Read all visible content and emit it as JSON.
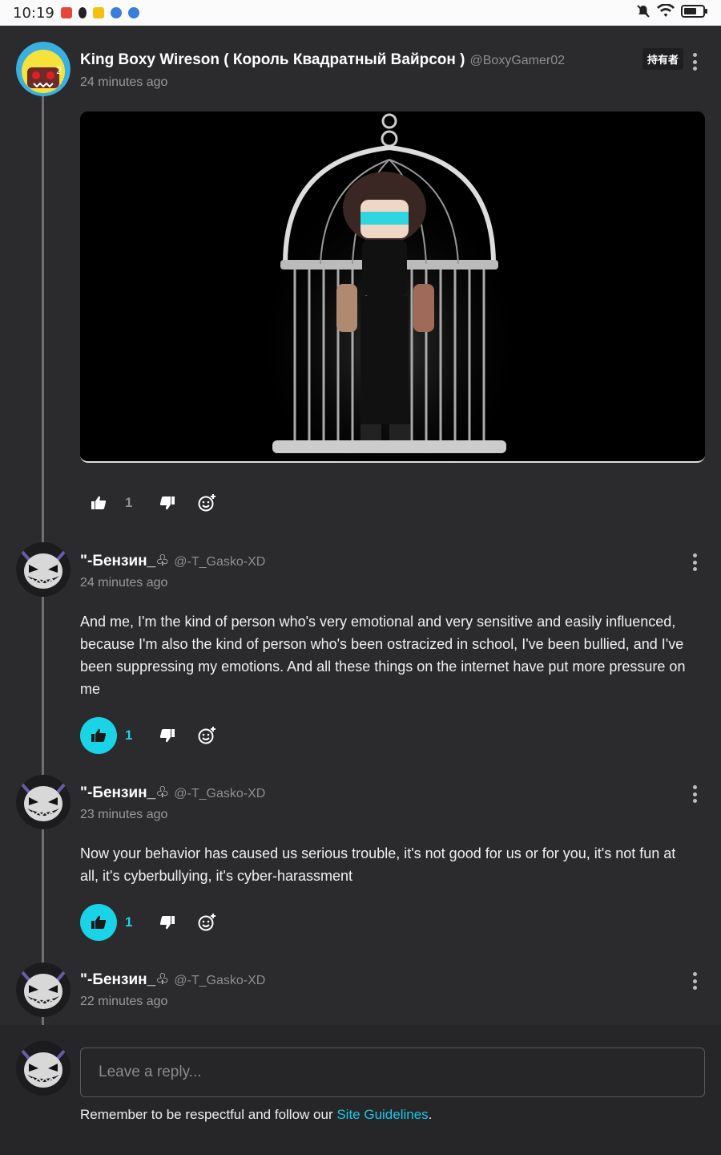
{
  "status_bar": {
    "time": "10:19"
  },
  "thread": {
    "original": {
      "username": "King Boxy Wireson ( Король Квадратный Вайрсон )",
      "handle": "@BoxyGamer02",
      "time": "24 minutes ago",
      "badge": "持有者",
      "likes": "1"
    },
    "replies": [
      {
        "username": "\"-Бензин_♧",
        "handle": "@-T_Gasko-XD",
        "time": "24 minutes ago",
        "text": "And me, I'm the kind of person who's very emotional and very sensitive and easily influenced, because I'm also the kind of person who's been ostracized in school, I've been bullied, and I've been suppressing my emotions. And all these things on the internet have put more pressure on me",
        "likes": "1"
      },
      {
        "username": "\"-Бензин_♧",
        "handle": "@-T_Gasko-XD",
        "time": "23 minutes ago",
        "text": "Now your behavior has caused us serious trouble, it's not good for us or for you, it's not fun at all, it's cyberbullying, it's cyber-harassment",
        "likes": "1"
      },
      {
        "username": "\"-Бензин_♧",
        "handle": "@-T_Gasko-XD",
        "time": "22 minutes ago"
      }
    ]
  },
  "reply_box": {
    "placeholder": "Leave a reply...",
    "notice": "Remember to be respectful and follow our ",
    "link": "Site Guidelines",
    "notice_end": "."
  },
  "colors": {
    "accent": "#19d4e6",
    "background": "#2b2a2c"
  }
}
